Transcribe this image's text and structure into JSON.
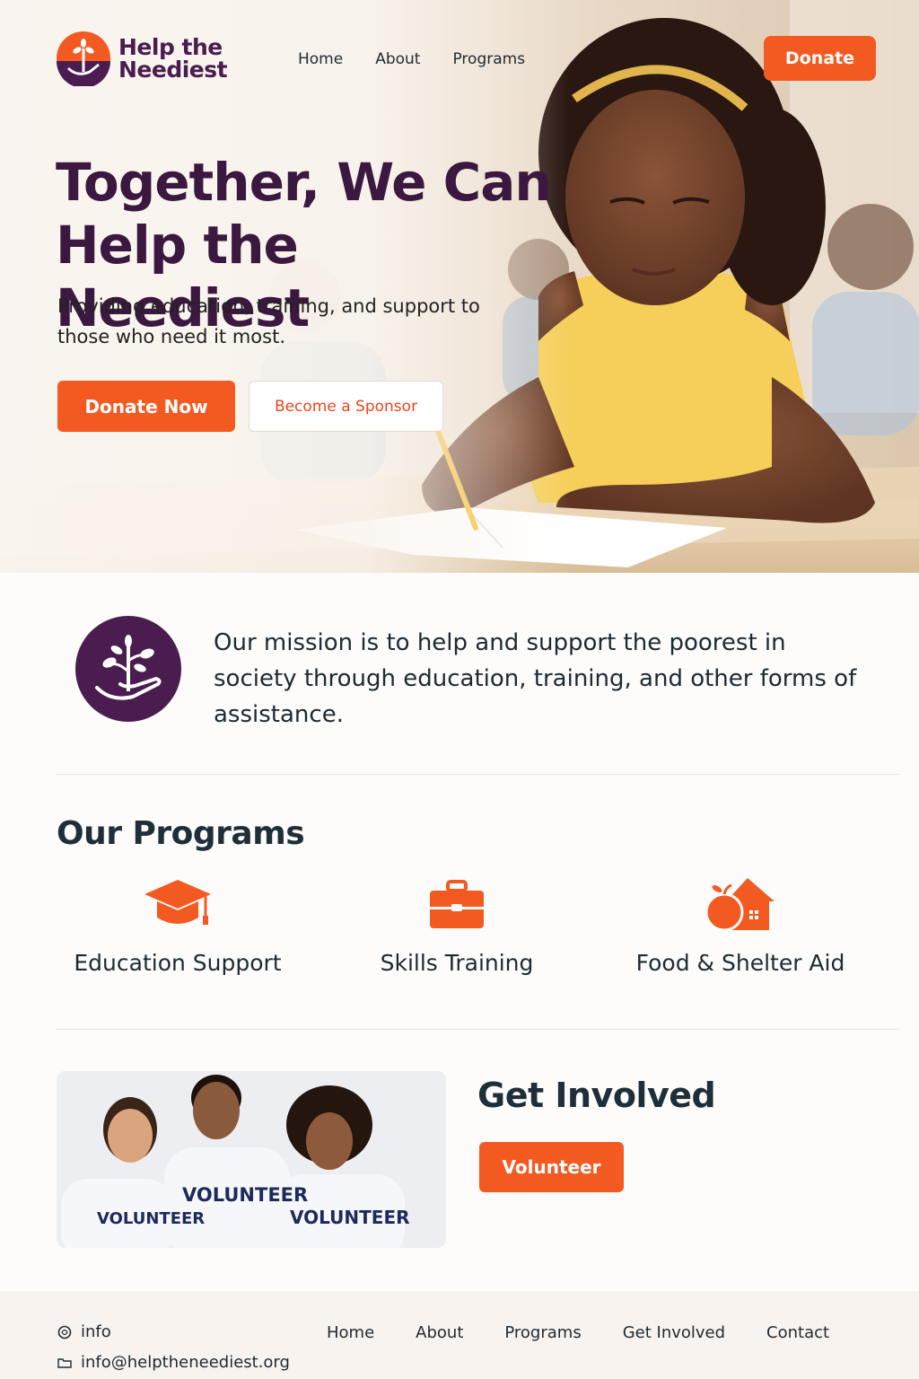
{
  "brand": {
    "name_line1": "Help the",
    "name_line2": "Neediest"
  },
  "nav": {
    "items": [
      "Home",
      "About",
      "Programs"
    ],
    "donate_label": "Donate"
  },
  "hero": {
    "title": "Together, We Can Help the Neediest",
    "subtitle": "Providing education, training, and support to those who need it most.",
    "primary_cta": "Donate Now",
    "secondary_cta": "Become a Sponsor"
  },
  "mission": {
    "text": "Our mission is to help and support the poorest in society through education, training, and other forms of assistance."
  },
  "programs": {
    "title": "Our Programs",
    "items": [
      {
        "label": "Education Support",
        "icon": "graduation-cap-icon"
      },
      {
        "label": "Skills Training",
        "icon": "briefcase-icon"
      },
      {
        "label": "Food & Shelter Aid",
        "icon": "apple-house-icon"
      }
    ]
  },
  "get_involved": {
    "title": "Get Involved",
    "cta": "Volunteer",
    "shirt_text": "VOLUNTEER"
  },
  "footer": {
    "contact_label": "info",
    "email": "info@helptheneediest.org",
    "nav": [
      "Home",
      "About",
      "Programs",
      "Get Involved",
      "Contact"
    ]
  },
  "colors": {
    "accent": "#f35a22",
    "brand_purple": "#4a1c4f",
    "heading_dark": "#1f2f3a"
  }
}
